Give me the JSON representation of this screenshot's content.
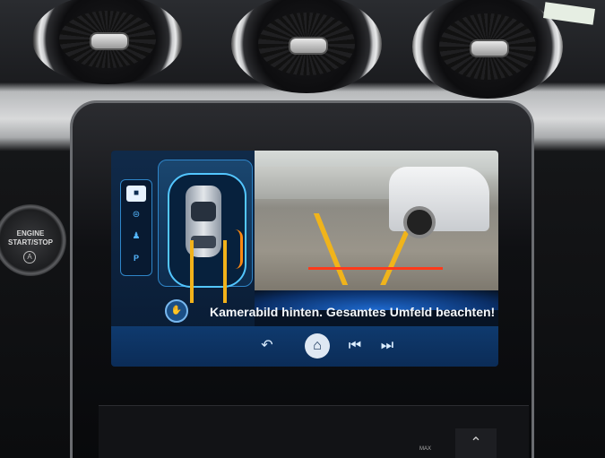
{
  "engine_button": {
    "line1": "ENGINE",
    "line2": "START/STOP",
    "symbol": "A"
  },
  "sidebar": {
    "items": [
      {
        "icon": "parking-mode-icon",
        "selected": true
      },
      {
        "icon": "sensor-icon",
        "selected": false
      },
      {
        "icon": "driver-icon",
        "selected": false
      },
      {
        "icon": "park-assist-icon",
        "label": "P"
      }
    ]
  },
  "message": "Kamerabild hinten. Gesamtes Umfeld beachten!",
  "bottom_nav": {
    "items": [
      {
        "icon": "back-arrow-icon",
        "glyph": "↶"
      },
      {
        "icon": "home-icon",
        "glyph": "⌂"
      },
      {
        "icon": "skip-previous-icon",
        "glyph": "⏮"
      },
      {
        "icon": "skip-next-icon",
        "glyph": "⏭"
      }
    ]
  },
  "lower_controls": {
    "max_label": "MAX",
    "chevron": "⌃"
  },
  "tag_text": "",
  "colors": {
    "screen_bg": "#071324",
    "accent_blue": "#53c6ff",
    "guide_yellow": "#f0b41b",
    "warn_orange": "#ff8a10",
    "home_button": "#dfe8f3"
  }
}
